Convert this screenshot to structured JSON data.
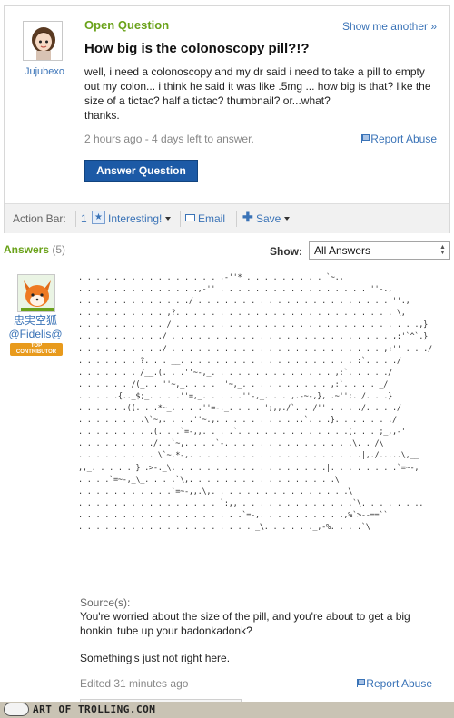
{
  "question": {
    "status_label": "Open Question",
    "show_another": "Show me another »",
    "asker_name": "Jujubexo",
    "title": "How big is the colonoscopy pill?!?",
    "body_lines": [
      "well, i need a colonoscopy and my dr said i need to take a pill to empty",
      "out my colon... i think he said it was like .5mg ... how big is that? like the",
      "size of a tictac? half a tictac? thumbnail? or...what?",
      "thanks."
    ],
    "meta": "2 hours ago - 4 days left to answer.",
    "report_abuse": "Report Abuse",
    "answer_button": "Answer Question"
  },
  "action_bar": {
    "label": "Action Bar:",
    "interesting_count": "1",
    "interesting": "Interesting!",
    "email": "Email",
    "save": "Save"
  },
  "answers_header": {
    "title": "Answers",
    "count": "(5)",
    "show_label": "Show:",
    "show_selected": "All Answers"
  },
  "answer": {
    "user_name": "忠実空狐",
    "user_tagline": "Fidelis",
    "badge_line1": "TOP",
    "badge_line2": "CONTRIBUTOR",
    "ascii_lines": [
      ". . . . . . . . . . . . . . . . ,-''* . . . . . . . . . `~.,",
      ". . . . . . . . . . . . . .,-'' . . . . . . . . . . . . . . . . . ''-.,",
      ". . . . . . . . . . . . ./ . . . . . . . . . . . . . . . . . . . . . . ''.,",
      ". . . . . . . . . . ,?. . . . . . . . . . . . . . . . . . . . . . . . . \\,",
      ". . . . . . . . . . / . . . . . . . . . . . . . . . . . . . . . . . . . . . .,}",
      ". . . . . . . . . ./ . . . . . . . . . . . . . . . . . . . . . . . . . ,:'`^`.}",
      ". . . . . . . . . ./ . . . . . . . . . . . . . . . . . . . . . . . . ,:'' . . ./",
      ". . . . . . . ?. . . __. . . . . . . . . . . . . . . . . . . . :`. . . ./",
      ". . . . . . . /__.(. . .''~-,_. . . . . . . . . . . . . . ,:`. . . . ./",
      ". . . . . . /(_. . ''~,_. . . . ''~,_. . . . . . . . . . ,:`. . . . _/",
      ". . . . .{.._$;_. . . .''=,_. . . . .''-,_. . . ,.-~-,}, .~'';. /. . .}",
      ". . . . . .((. . .*~_. . . .''=-._. . . .'';,,./`. . /'' . . . ./. . . ./",
      ". . . . . . . .\\`~,. . . .''~.,. . . . . . . . . ..`. . .}. . . . . . ./",
      ". . . . . . . . .(. . .`=-,,. . . .`. . . . . . . . . . . . .(. . . ;_,,-'",
      ". . . . . . . . ./. .`~,. . . .`-. . . . . . . . . . . . . . .\\. . /\\",
      ". . . . . . . . . \\`~.*-,. . . . . . . . . . . . . . . . . . . .|,./.....\\,__",
      ",,_. . . . . } .>-._\\. . . . . . . . . . . . . . . . . .|. . . . . . . .`=~-,",
      ". . . .`=~-,_\\_. . . .`\\,. . . . . . . . . . . . . . . . .\\",
      ". . . . . . . . . . .`=~-,,.\\,. . . . . . . . . . . . . . . .\\",
      ". . . . . . . . . . . . . . . . `:,, . . . . . . . . . . . . .`\\. . . . . . ..__",
      ". . . . . . . . . . . . . . . . . . .`=-,. . . . . . . . . .,%`>--==``",
      ". . . . . . . . . . . . . . . . . . . . _\\. . . . . ._,-%. . . .`\\"
    ],
    "source_label": "Source(s):",
    "source_text": "You're worried about the size of the pill, and you're about to get a big honkin' tube up your badonkadonk?",
    "source_text2": "Something's just not right here.",
    "edited": "Edited 31 minutes ago",
    "report_abuse": "Report Abuse"
  },
  "footer": {
    "watermark": "ART OF TROLLING.COM"
  },
  "colors": {
    "accent_green": "#6aa21a",
    "link_blue": "#3a73b7",
    "button_blue": "#1c5aa6",
    "badge_orange": "#e89a1c"
  }
}
